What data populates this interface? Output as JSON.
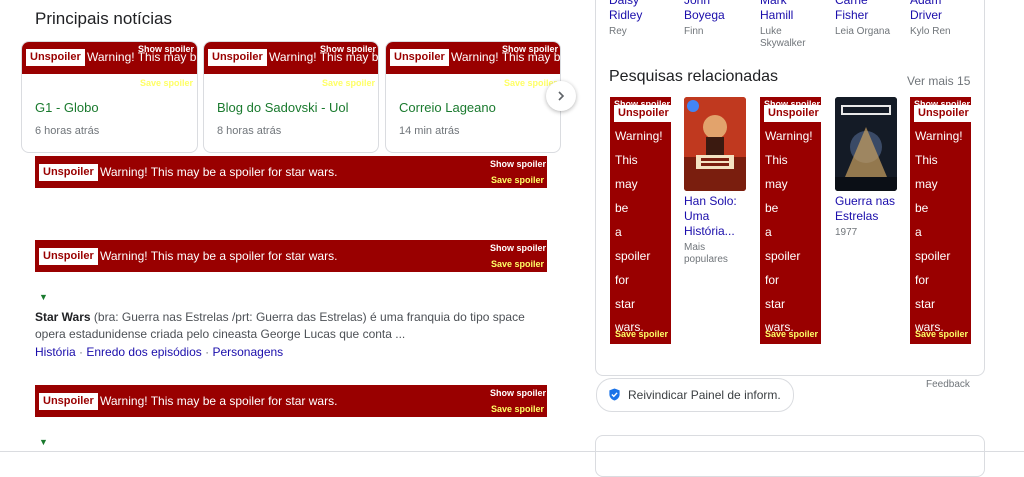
{
  "section_title": "Principais notícias",
  "spoiler": {
    "unspoiler": "Unspoiler",
    "warning": "Warning! This may be a spoiler for star wars.",
    "warning_short": "Warning! This may b",
    "show": "Show spoiler",
    "save": "Save spoiler",
    "vertical_words": [
      "Warning!",
      "This",
      "may",
      "be",
      "a",
      "spoiler",
      "for",
      "star",
      "wars."
    ]
  },
  "news_cards": [
    {
      "source": "G1 - Globo",
      "time": "6 horas atrás"
    },
    {
      "source": "Blog do Sadovski - Uol",
      "time": "8 horas atrás"
    },
    {
      "source": "Correio Lageano",
      "time": "14 min atrás"
    }
  ],
  "next_icon": "chevron-right-icon",
  "snippet": {
    "bold": "Star Wars",
    "text": " (bra: Guerra nas Estrelas /prt: Guerra das Estrelas) é uma franquia do tipo space opera estadunidense criada pelo cineasta George Lucas que conta ...",
    "links": [
      "História",
      "Enredo dos episódios",
      "Personagens"
    ],
    "sep": " · "
  },
  "cast": [
    {
      "name1": "Daisy",
      "name2": "Ridley",
      "role1": "Rey",
      "role2": ""
    },
    {
      "name1": "John",
      "name2": "Boyega",
      "role1": "Finn",
      "role2": ""
    },
    {
      "name1": "Mark",
      "name2": "Hamill",
      "role1": "Luke",
      "role2": "Skywalker"
    },
    {
      "name1": "Carrie",
      "name2": "Fisher",
      "role1": "Leia Organa",
      "role2": ""
    },
    {
      "name1": "Adam",
      "name2": "Driver",
      "role1": "Kylo Ren",
      "role2": ""
    }
  ],
  "related": {
    "title": "Pesquisas relacionadas",
    "see_more": "Ver mais 15",
    "movies": [
      {
        "title1": "Han Solo:",
        "title2": "Uma",
        "title3": "História...",
        "sub1": "Mais",
        "sub2": "populares"
      },
      {
        "title1": "Guerra nas",
        "title2": "Estrelas",
        "title3": "",
        "sub1": "1977",
        "sub2": ""
      }
    ]
  },
  "claim_panel": "Reivindicar Painel de inform.",
  "feedback": "Feedback",
  "colors": {
    "spoiler_red": "#990000",
    "save_yellow": "#ffff66",
    "link_blue": "#1a0dab",
    "source_green": "#1a7a2e"
  }
}
